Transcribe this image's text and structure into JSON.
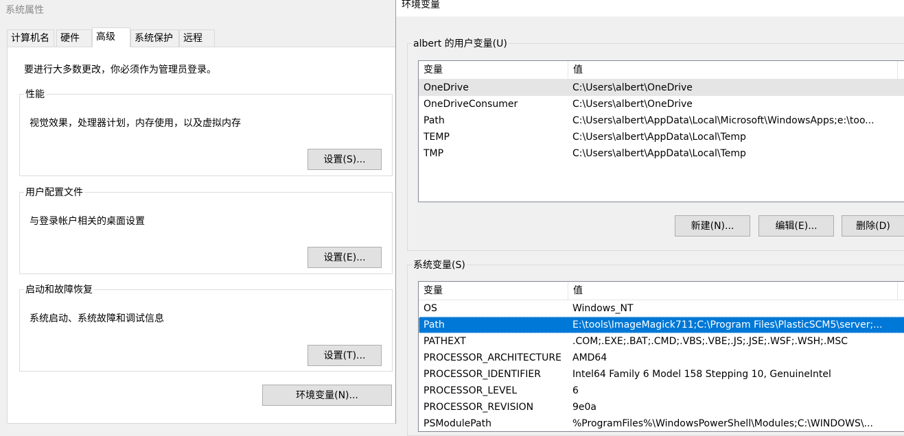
{
  "system_properties": {
    "title": "系统属性",
    "tabs": [
      "计算机名",
      "硬件",
      "高级",
      "系统保护",
      "远程"
    ],
    "active_tab": "高级",
    "admin_note": "要进行大多数更改，你必须作为管理员登录。",
    "performance": {
      "legend": "性能",
      "description": "视觉效果，处理器计划，内存使用，以及虚拟内存",
      "button": "设置(S)..."
    },
    "user_profiles": {
      "legend": "用户配置文件",
      "description": "与登录帐户相关的桌面设置",
      "button": "设置(E)..."
    },
    "startup_recovery": {
      "legend": "启动和故障恢复",
      "description": "系统启动、系统故障和调试信息",
      "button": "设置(T)..."
    },
    "env_button": "环境变量(N)..."
  },
  "environment_variables": {
    "title": "环境变量",
    "user_section": {
      "legend": "albert 的用户变量(U)",
      "columns": [
        "变量",
        "值"
      ],
      "rows": [
        {
          "name": "OneDrive",
          "value": "C:\\Users\\albert\\OneDrive"
        },
        {
          "name": "OneDriveConsumer",
          "value": "C:\\Users\\albert\\OneDrive"
        },
        {
          "name": "Path",
          "value": "C:\\Users\\albert\\AppData\\Local\\Microsoft\\WindowsApps;e:\\too..."
        },
        {
          "name": "TEMP",
          "value": "C:\\Users\\albert\\AppData\\Local\\Temp"
        },
        {
          "name": "TMP",
          "value": "C:\\Users\\albert\\AppData\\Local\\Temp"
        }
      ],
      "buttons": {
        "new": "新建(N)...",
        "edit": "编辑(E)...",
        "delete": "删除(D)"
      }
    },
    "system_section": {
      "legend": "系统变量(S)",
      "columns": [
        "变量",
        "值"
      ],
      "rows": [
        {
          "name": "OS",
          "value": "Windows_NT"
        },
        {
          "name": "Path",
          "value": "E:\\tools\\ImageMagick711;C:\\Program Files\\PlasticSCM5\\server;..."
        },
        {
          "name": "PATHEXT",
          "value": ".COM;.EXE;.BAT;.CMD;.VBS;.VBE;.JS;.JSE;.WSF;.WSH;.MSC"
        },
        {
          "name": "PROCESSOR_ARCHITECTURE",
          "value": "AMD64"
        },
        {
          "name": "PROCESSOR_IDENTIFIER",
          "value": "Intel64 Family 6 Model 158 Stepping 10, GenuineIntel"
        },
        {
          "name": "PROCESSOR_LEVEL",
          "value": "6"
        },
        {
          "name": "PROCESSOR_REVISION",
          "value": "9e0a"
        },
        {
          "name": "PSModulePath",
          "value": "%ProgramFiles%\\WindowsPowerShell\\Modules;C:\\WINDOWS\\..."
        }
      ]
    },
    "selection_color": "#0078d7"
  }
}
